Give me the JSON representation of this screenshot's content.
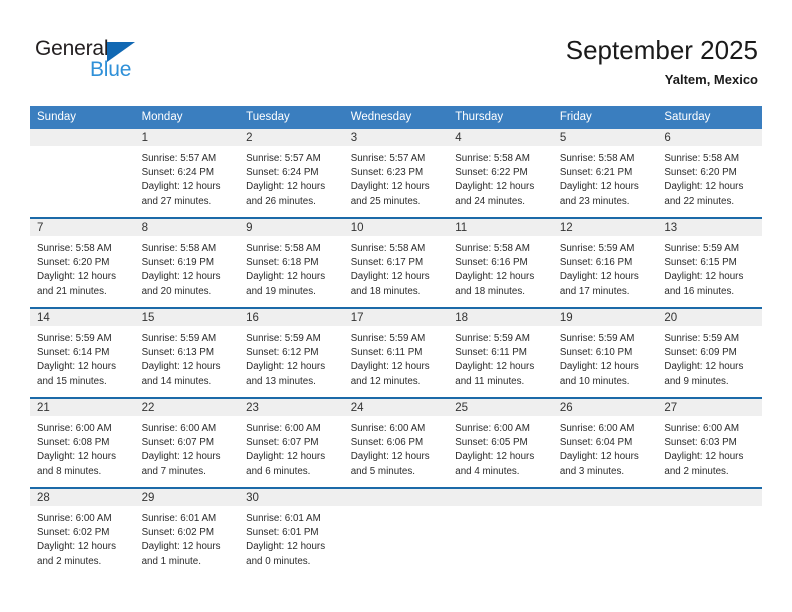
{
  "brand": {
    "name_part1": "General",
    "name_part2": "Blue",
    "triangle_color": "#1168b3",
    "blue_text_color": "#2f90d8"
  },
  "header": {
    "title": "September 2025",
    "subtitle": "Yaltem, Mexico",
    "header_bg_color": "#3a7ebf",
    "header_text_color": "#ffffff",
    "row_divider_color": "#1c6aa8",
    "daynum_strip_color": "#efefef"
  },
  "weekdays": [
    "Sunday",
    "Monday",
    "Tuesday",
    "Wednesday",
    "Thursday",
    "Friday",
    "Saturday"
  ],
  "weeks": [
    [
      {
        "day": "",
        "sunrise": "",
        "sunset": "",
        "daylight_line1": "",
        "daylight_line2": "",
        "empty": true
      },
      {
        "day": "1",
        "sunrise": "Sunrise: 5:57 AM",
        "sunset": "Sunset: 6:24 PM",
        "daylight_line1": "Daylight: 12 hours",
        "daylight_line2": "and 27 minutes."
      },
      {
        "day": "2",
        "sunrise": "Sunrise: 5:57 AM",
        "sunset": "Sunset: 6:24 PM",
        "daylight_line1": "Daylight: 12 hours",
        "daylight_line2": "and 26 minutes."
      },
      {
        "day": "3",
        "sunrise": "Sunrise: 5:57 AM",
        "sunset": "Sunset: 6:23 PM",
        "daylight_line1": "Daylight: 12 hours",
        "daylight_line2": "and 25 minutes."
      },
      {
        "day": "4",
        "sunrise": "Sunrise: 5:58 AM",
        "sunset": "Sunset: 6:22 PM",
        "daylight_line1": "Daylight: 12 hours",
        "daylight_line2": "and 24 minutes."
      },
      {
        "day": "5",
        "sunrise": "Sunrise: 5:58 AM",
        "sunset": "Sunset: 6:21 PM",
        "daylight_line1": "Daylight: 12 hours",
        "daylight_line2": "and 23 minutes."
      },
      {
        "day": "6",
        "sunrise": "Sunrise: 5:58 AM",
        "sunset": "Sunset: 6:20 PM",
        "daylight_line1": "Daylight: 12 hours",
        "daylight_line2": "and 22 minutes."
      }
    ],
    [
      {
        "day": "7",
        "sunrise": "Sunrise: 5:58 AM",
        "sunset": "Sunset: 6:20 PM",
        "daylight_line1": "Daylight: 12 hours",
        "daylight_line2": "and 21 minutes."
      },
      {
        "day": "8",
        "sunrise": "Sunrise: 5:58 AM",
        "sunset": "Sunset: 6:19 PM",
        "daylight_line1": "Daylight: 12 hours",
        "daylight_line2": "and 20 minutes."
      },
      {
        "day": "9",
        "sunrise": "Sunrise: 5:58 AM",
        "sunset": "Sunset: 6:18 PM",
        "daylight_line1": "Daylight: 12 hours",
        "daylight_line2": "and 19 minutes."
      },
      {
        "day": "10",
        "sunrise": "Sunrise: 5:58 AM",
        "sunset": "Sunset: 6:17 PM",
        "daylight_line1": "Daylight: 12 hours",
        "daylight_line2": "and 18 minutes."
      },
      {
        "day": "11",
        "sunrise": "Sunrise: 5:58 AM",
        "sunset": "Sunset: 6:16 PM",
        "daylight_line1": "Daylight: 12 hours",
        "daylight_line2": "and 18 minutes."
      },
      {
        "day": "12",
        "sunrise": "Sunrise: 5:59 AM",
        "sunset": "Sunset: 6:16 PM",
        "daylight_line1": "Daylight: 12 hours",
        "daylight_line2": "and 17 minutes."
      },
      {
        "day": "13",
        "sunrise": "Sunrise: 5:59 AM",
        "sunset": "Sunset: 6:15 PM",
        "daylight_line1": "Daylight: 12 hours",
        "daylight_line2": "and 16 minutes."
      }
    ],
    [
      {
        "day": "14",
        "sunrise": "Sunrise: 5:59 AM",
        "sunset": "Sunset: 6:14 PM",
        "daylight_line1": "Daylight: 12 hours",
        "daylight_line2": "and 15 minutes."
      },
      {
        "day": "15",
        "sunrise": "Sunrise: 5:59 AM",
        "sunset": "Sunset: 6:13 PM",
        "daylight_line1": "Daylight: 12 hours",
        "daylight_line2": "and 14 minutes."
      },
      {
        "day": "16",
        "sunrise": "Sunrise: 5:59 AM",
        "sunset": "Sunset: 6:12 PM",
        "daylight_line1": "Daylight: 12 hours",
        "daylight_line2": "and 13 minutes."
      },
      {
        "day": "17",
        "sunrise": "Sunrise: 5:59 AM",
        "sunset": "Sunset: 6:11 PM",
        "daylight_line1": "Daylight: 12 hours",
        "daylight_line2": "and 12 minutes."
      },
      {
        "day": "18",
        "sunrise": "Sunrise: 5:59 AM",
        "sunset": "Sunset: 6:11 PM",
        "daylight_line1": "Daylight: 12 hours",
        "daylight_line2": "and 11 minutes."
      },
      {
        "day": "19",
        "sunrise": "Sunrise: 5:59 AM",
        "sunset": "Sunset: 6:10 PM",
        "daylight_line1": "Daylight: 12 hours",
        "daylight_line2": "and 10 minutes."
      },
      {
        "day": "20",
        "sunrise": "Sunrise: 5:59 AM",
        "sunset": "Sunset: 6:09 PM",
        "daylight_line1": "Daylight: 12 hours",
        "daylight_line2": "and 9 minutes."
      }
    ],
    [
      {
        "day": "21",
        "sunrise": "Sunrise: 6:00 AM",
        "sunset": "Sunset: 6:08 PM",
        "daylight_line1": "Daylight: 12 hours",
        "daylight_line2": "and 8 minutes."
      },
      {
        "day": "22",
        "sunrise": "Sunrise: 6:00 AM",
        "sunset": "Sunset: 6:07 PM",
        "daylight_line1": "Daylight: 12 hours",
        "daylight_line2": "and 7 minutes."
      },
      {
        "day": "23",
        "sunrise": "Sunrise: 6:00 AM",
        "sunset": "Sunset: 6:07 PM",
        "daylight_line1": "Daylight: 12 hours",
        "daylight_line2": "and 6 minutes."
      },
      {
        "day": "24",
        "sunrise": "Sunrise: 6:00 AM",
        "sunset": "Sunset: 6:06 PM",
        "daylight_line1": "Daylight: 12 hours",
        "daylight_line2": "and 5 minutes."
      },
      {
        "day": "25",
        "sunrise": "Sunrise: 6:00 AM",
        "sunset": "Sunset: 6:05 PM",
        "daylight_line1": "Daylight: 12 hours",
        "daylight_line2": "and 4 minutes."
      },
      {
        "day": "26",
        "sunrise": "Sunrise: 6:00 AM",
        "sunset": "Sunset: 6:04 PM",
        "daylight_line1": "Daylight: 12 hours",
        "daylight_line2": "and 3 minutes."
      },
      {
        "day": "27",
        "sunrise": "Sunrise: 6:00 AM",
        "sunset": "Sunset: 6:03 PM",
        "daylight_line1": "Daylight: 12 hours",
        "daylight_line2": "and 2 minutes."
      }
    ],
    [
      {
        "day": "28",
        "sunrise": "Sunrise: 6:00 AM",
        "sunset": "Sunset: 6:02 PM",
        "daylight_line1": "Daylight: 12 hours",
        "daylight_line2": "and 2 minutes."
      },
      {
        "day": "29",
        "sunrise": "Sunrise: 6:01 AM",
        "sunset": "Sunset: 6:02 PM",
        "daylight_line1": "Daylight: 12 hours",
        "daylight_line2": "and 1 minute."
      },
      {
        "day": "30",
        "sunrise": "Sunrise: 6:01 AM",
        "sunset": "Sunset: 6:01 PM",
        "daylight_line1": "Daylight: 12 hours",
        "daylight_line2": "and 0 minutes."
      },
      {
        "day": "",
        "sunrise": "",
        "sunset": "",
        "daylight_line1": "",
        "daylight_line2": "",
        "empty": true
      },
      {
        "day": "",
        "sunrise": "",
        "sunset": "",
        "daylight_line1": "",
        "daylight_line2": "",
        "empty": true
      },
      {
        "day": "",
        "sunrise": "",
        "sunset": "",
        "daylight_line1": "",
        "daylight_line2": "",
        "empty": true
      },
      {
        "day": "",
        "sunrise": "",
        "sunset": "",
        "daylight_line1": "",
        "daylight_line2": "",
        "empty": true
      }
    ]
  ]
}
